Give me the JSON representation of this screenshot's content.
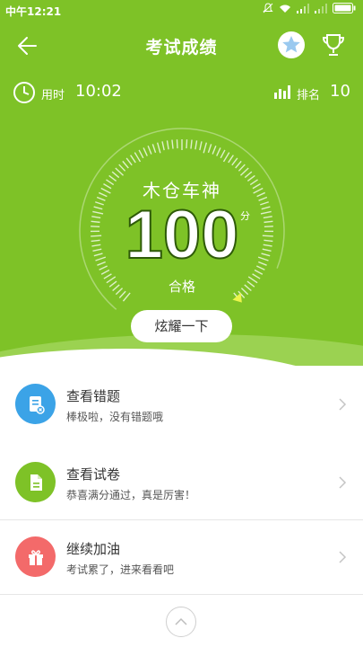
{
  "status_bar": {
    "time": "中午12:21"
  },
  "header": {
    "title": "考试成绩"
  },
  "stats": {
    "time_label": "用时",
    "time_value": "10:02",
    "rank_label": "排名",
    "rank_value": "10"
  },
  "result": {
    "nickname": "木仓车神",
    "score": "100",
    "score_unit": "分",
    "grade": "合格",
    "score_fraction": 1.0
  },
  "share_button": {
    "label": "炫耀一下"
  },
  "actions": [
    {
      "title": "查看错题",
      "subtitle": "棒极啦，没有错题哦",
      "icon": "wrong-questions-icon",
      "color": "#3ba3e7"
    },
    {
      "title": "查看试卷",
      "subtitle": "恭喜满分通过，真是厉害！",
      "icon": "paper-document-icon",
      "color": "#7ec227"
    },
    {
      "title": "继续加油",
      "subtitle": "考试累了，进来看看吧",
      "icon": "gift-icon",
      "color": "#f36a6a"
    }
  ],
  "colors": {
    "theme_green": "#7ec227",
    "blue": "#3ba3e7",
    "red": "#f36a6a",
    "gauge_marker": "#ecf44c"
  }
}
